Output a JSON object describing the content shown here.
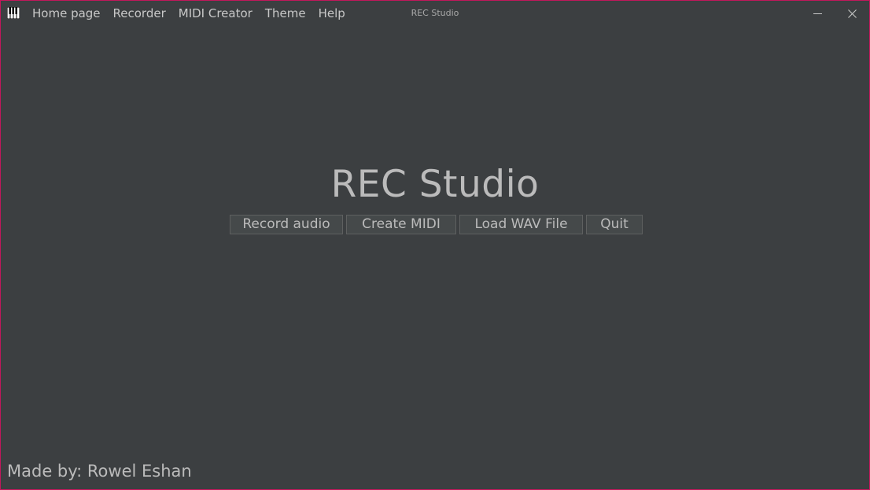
{
  "window": {
    "title": "REC Studio",
    "border_color": "#c2185b",
    "background": "#3c3f41"
  },
  "menu": {
    "items": [
      {
        "label": "Home page"
      },
      {
        "label": "Recorder"
      },
      {
        "label": "MIDI Creator"
      },
      {
        "label": "Theme"
      },
      {
        "label": "Help"
      }
    ]
  },
  "icons": {
    "app": "piano-icon",
    "minimize": "minimize-icon",
    "close": "close-icon"
  },
  "main": {
    "title": "REC Studio",
    "buttons": [
      {
        "label": "Record audio"
      },
      {
        "label": "Create MIDI"
      },
      {
        "label": "Load WAV File"
      },
      {
        "label": "Quit"
      }
    ]
  },
  "footer": {
    "credit": "Made by: Rowel Eshan"
  }
}
